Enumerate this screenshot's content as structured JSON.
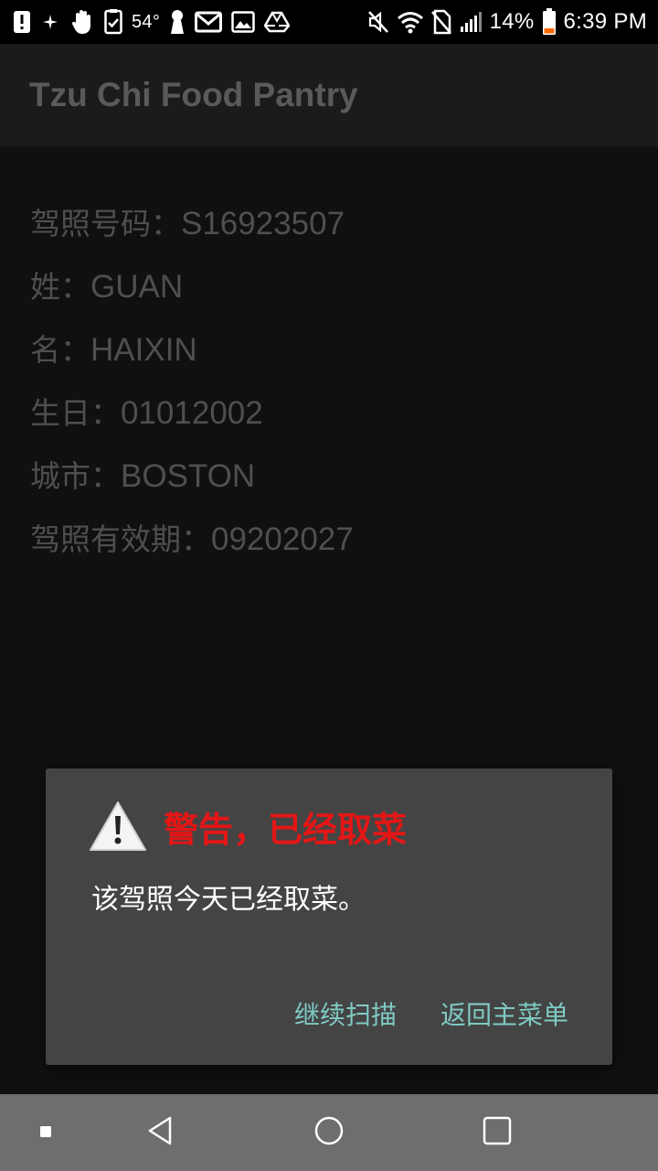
{
  "status_bar": {
    "temperature": "54°",
    "battery_percent": "14%",
    "time": "6:39 PM",
    "icons": [
      "alert-icon",
      "sparkle-icon",
      "hand-icon",
      "clipboard-icon",
      "keyhole-icon",
      "gmail-icon",
      "image-icon",
      "drive-icon",
      "mute-icon",
      "wifi-icon",
      "no-sim-icon",
      "signal-icon",
      "battery-icon"
    ]
  },
  "app_bar": {
    "title": "Tzu Chi Food Pantry"
  },
  "fields": {
    "license_number": {
      "label": "驾照号码：",
      "value": "S16923507"
    },
    "last_name": {
      "label": "姓：",
      "value": "GUAN"
    },
    "first_name": {
      "label": "名：",
      "value": "HAIXIN"
    },
    "birthday": {
      "label": "生日：",
      "value": "01012002"
    },
    "city": {
      "label": "城市：",
      "value": "BOSTON"
    },
    "license_expiry": {
      "label": "驾照有效期：",
      "value": "09202027"
    }
  },
  "dialog": {
    "icon": "warning-icon",
    "title": "警告，已经取菜",
    "message": "该驾照今天已经取菜。",
    "continue_button": "继续扫描",
    "back_button": "返回主菜单"
  },
  "nav_bar": {
    "icons": [
      "menu-dot-icon",
      "back-icon",
      "home-icon",
      "recents-icon"
    ]
  },
  "colors": {
    "dialog_title": "#e41616",
    "dialog_button": "#7fcac3",
    "dialog_bg": "#444444",
    "field_text": "#4f4f4f",
    "navbar_bg": "#6e6e6e"
  }
}
